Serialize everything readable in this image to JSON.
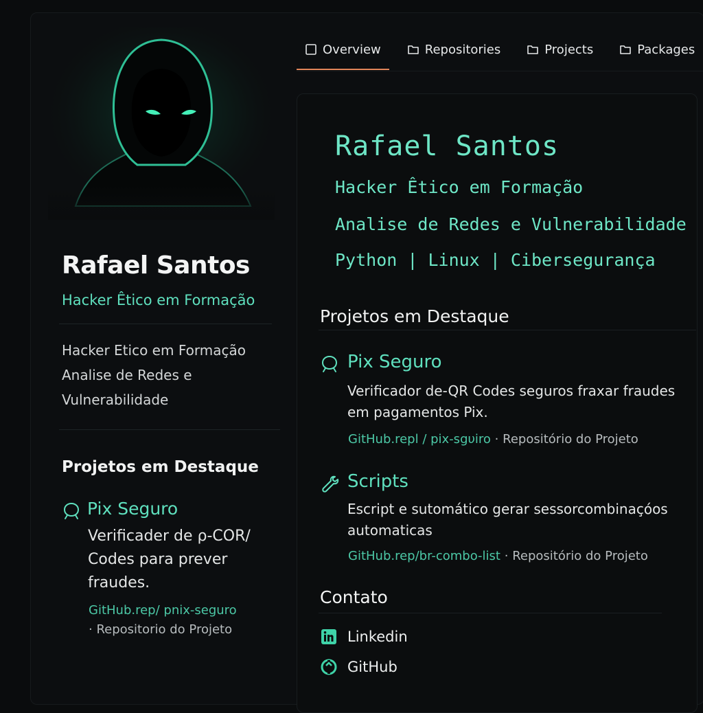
{
  "tabs": [
    {
      "label": "Overview",
      "icon": "book-icon",
      "active": true
    },
    {
      "label": "Repositories",
      "icon": "folder-icon",
      "active": false
    },
    {
      "label": "Projects",
      "icon": "folder-icon",
      "active": false
    },
    {
      "label": "Packages",
      "icon": "folder-icon",
      "active": false
    }
  ],
  "sidebar": {
    "name": "Rafael Santos",
    "role": "Hacker Êtico em Formação",
    "bio": [
      "Hacker Etico em Formação",
      "Analise de Redes e",
      "Vulnerabilidade"
    ],
    "section_title": "Projetos em Destaque",
    "project": {
      "title": "Pix Seguro",
      "desc": [
        "Verificader de ρ-COR/",
        "Codes para prever",
        "fraudes."
      ],
      "link": "GitHub.rep/ pnix-seguro",
      "meta": "· Repositorio do Projeto"
    }
  },
  "main": {
    "hero": {
      "name": "Rafael Santos",
      "line1": "Hacker Êtico em Formação",
      "line2": "Analise de Redes e Vulnerabilidade",
      "line3": "Python | Linux | Cibersegurança"
    },
    "section_projects": "Projetos em Destaque",
    "projects": [
      {
        "title": "Pix Seguro",
        "icon": "shield-icon",
        "desc": [
          "Verificador de-QR Codes seguros fraxar fraudes",
          "em pagamentos Pix."
        ],
        "link": "GitHub.repl / pix-sgυiro",
        "sep": "·",
        "meta": "Repositório do Projeto"
      },
      {
        "title": "Scripts",
        "icon": "wrench-icon",
        "desc": [
          "Escript e sutomático gerar sessorcombinaçόos",
          "automaticas"
        ],
        "link": "GitHub.rep/br-combo-list",
        "sep": "·",
        "meta": "Repositório do Projeto"
      }
    ],
    "section_contact": "Contato",
    "contacts": [
      {
        "label": "Linkedin",
        "icon": "linkedin-icon"
      },
      {
        "label": "GitHub",
        "icon": "github-icon"
      }
    ]
  },
  "colors": {
    "accent": "#5fe0be",
    "tab_active": "#e2855a",
    "background": "#0a0c0d"
  }
}
